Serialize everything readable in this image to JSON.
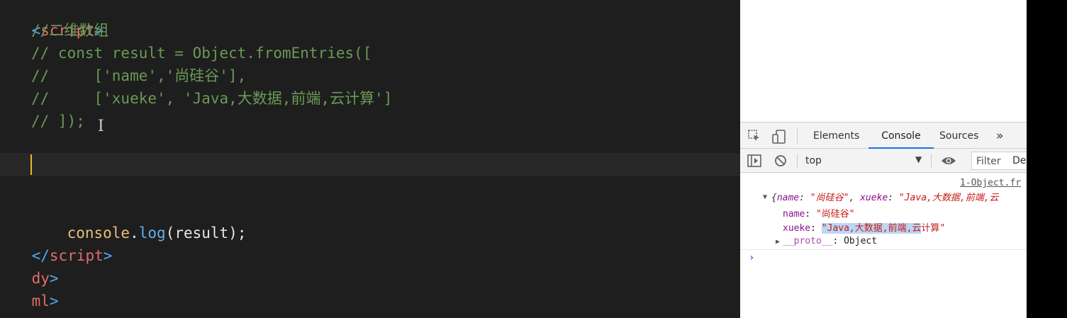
{
  "editor": {
    "lines": {
      "l1": {
        "open": "<",
        "name": "script",
        "close": ">"
      },
      "l2": "//二维数组",
      "l3": "// const result = Object.fromEntries([",
      "l4": "//     ['name','尚硅谷'],",
      "l5": "//     ['xueke', 'Java,大数据,前端,云计算']",
      "l6": "// ]);",
      "l7": {
        "obj": "console",
        "dot": ".",
        "method": "log",
        "args": "(result);"
      },
      "l8": {
        "open": "</",
        "name": "script",
        "close": ">"
      },
      "l9": {
        "name": "dy",
        "close": ">"
      },
      "l10": {
        "name": "ml",
        "close": ">"
      }
    }
  },
  "devtools": {
    "tabs": [
      "Elements",
      "Console",
      "Sources"
    ],
    "more_tabs_icon": "»",
    "active_tab": "Console",
    "context": "top",
    "filter_placeholder": "Filter",
    "levels_label": "De",
    "source_link": "1-Object.fr",
    "object_summary": {
      "open": "{",
      "k1": "name",
      "colon1": ": ",
      "v1": "\"尚硅谷\"",
      "sep": ", ",
      "k2": "xueke",
      "colon2": ": ",
      "v2": "\"Java,大数据,前端,云"
    },
    "props": {
      "name": {
        "key": "name",
        "colon": ": ",
        "value": "\"尚硅谷\""
      },
      "xueke": {
        "key": "xueke",
        "colon": ": ",
        "value_selected": "\"Java,大数据,前端,云",
        "value_rest": "计算\""
      },
      "proto": {
        "key": "__proto__",
        "colon": ": ",
        "value": "Object"
      }
    },
    "prompt": "›"
  },
  "icons": {
    "inspect": "inspect-element-icon",
    "device": "device-toolbar-icon",
    "sidebar": "console-sidebar-icon",
    "clear": "clear-console-icon",
    "eye": "live-expression-eye-icon"
  },
  "colors": {
    "editor_bg": "#1e1e1e",
    "comment": "#6a9955",
    "tag": "#e06c6c",
    "string": "#c41a16",
    "key": "#881391",
    "active_tab": "#1a73e8"
  }
}
